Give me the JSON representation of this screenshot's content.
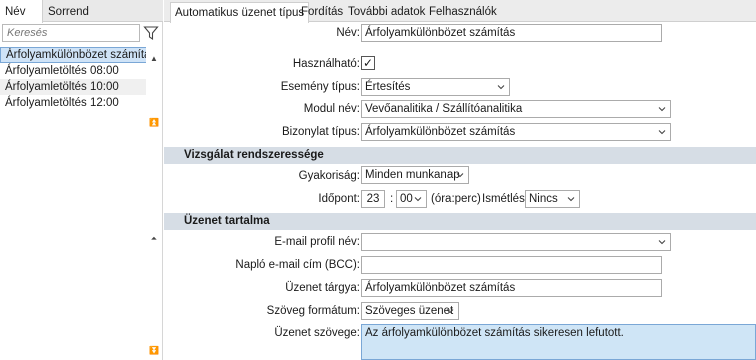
{
  "left_panel": {
    "tabs": [
      "Név",
      "Sorrend"
    ],
    "search_placeholder": "Keresés",
    "items": [
      "Árfolyamkülönbözet számítás",
      "Árfolyamletöltés 08:00",
      "Árfolyamletöltés 10:00",
      "Árfolyamletöltés 12:00"
    ],
    "scroll_glyphs": {
      "up": "▲",
      "top": "⏫",
      "prev": "⏶",
      "bottom": "⏬"
    }
  },
  "right_panel": {
    "tabs": [
      "Automatikus üzenet típus",
      "Fordítás",
      "További adatok",
      "Felhasználók"
    ],
    "form": {
      "name_label": "Név:",
      "name_value": "Árfolyamkülönbözet számítás",
      "usable_label": "Használható:",
      "usable_checked": "✓",
      "event_type_label": "Esemény típus:",
      "event_type_value": "Értesítés",
      "module_label": "Modul név:",
      "module_value": "Vevőanalitika / Szállítóanalitika",
      "document_type_label": "Bizonylat típus:",
      "document_type_value": "Árfolyamkülönbözet számítás"
    },
    "section_schedule": {
      "title": "Vizsgálat rendszeressége",
      "frequency_label": "Gyakoriság:",
      "frequency_value": "Minden munkanap",
      "time_label": "Időpont:",
      "hour_value": "23",
      "colon": ":",
      "minute_value": "00",
      "time_format_hint": "(óra:perc)",
      "repeat_label": "Ismétlés:",
      "repeat_value": "Nincs"
    },
    "section_message": {
      "title": "Üzenet tartalma",
      "email_profile_label": "E-mail profil név:",
      "email_profile_value": "",
      "log_email_label": "Napló e-mail cím (BCC):",
      "log_email_value": "",
      "subject_label": "Üzenet tárgya:",
      "subject_value": "Árfolyamkülönbözet számítás",
      "text_format_label": "Szöveg formátum:",
      "text_format_value": "Szöveges üzenet",
      "body_label": "Üzenet szövege:",
      "body_value": "Az árfolyamkülönbözet számítás sikeresen lefutott."
    }
  }
}
